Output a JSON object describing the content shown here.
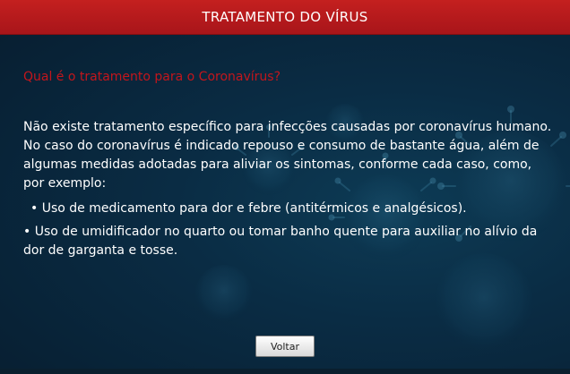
{
  "header": {
    "title": "TRATAMENTO DO VÍRUS",
    "color": "#b81b1f"
  },
  "content": {
    "question": "Qual é o tratamento para o Coronavírus?",
    "question_color": "#c3161c",
    "paragraph": "Não existe tratamento específico para infecções causadas por coronavírus humano. No caso do coronavírus é indicado repouso e consumo de bastante água, além de algumas medidas adotadas para aliviar os sintomas, conforme cada caso, como, por exemplo:",
    "bullets": [
      "• Uso de medicamento para dor e febre (antitérmicos e analgésicos).",
      "• Uso de umidificador no quarto ou tomar banho quente para auxiliar no alívio da dor de garganta e tosse."
    ]
  },
  "buttons": {
    "back_label": "Voltar"
  },
  "background": {
    "color": "#0a2c44",
    "decoration": "coronavirus-illustration"
  }
}
